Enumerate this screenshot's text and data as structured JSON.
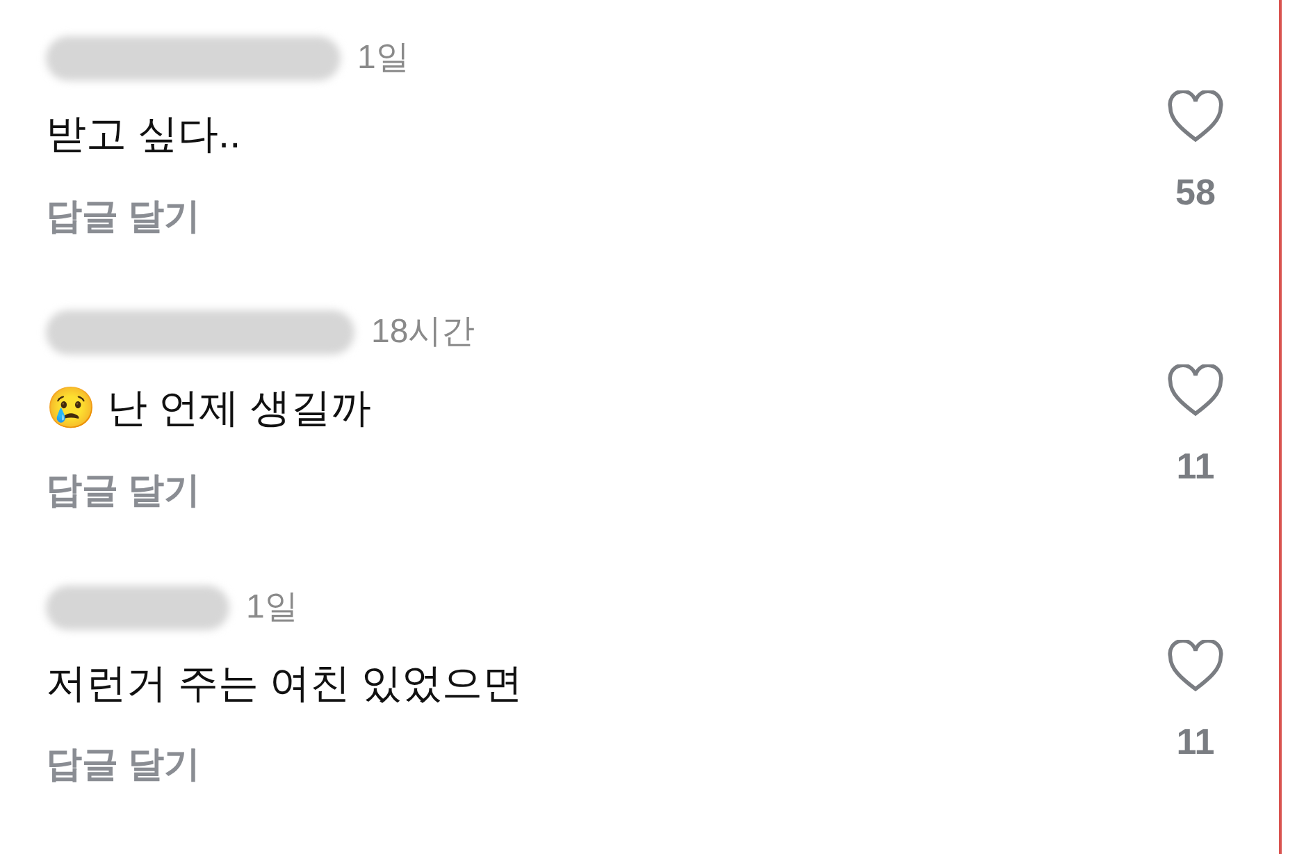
{
  "comments": [
    {
      "time": "1일",
      "text": "받고 싶다..",
      "reply": "답글 달기",
      "likes": "58"
    },
    {
      "time": "18시간",
      "text": "😢 난 언제 생길까",
      "reply": "답글 달기",
      "likes": "11"
    },
    {
      "time": "1일",
      "text": "저런거 주는 여친 있었으면",
      "reply": "답글 달기",
      "likes": "11"
    }
  ]
}
